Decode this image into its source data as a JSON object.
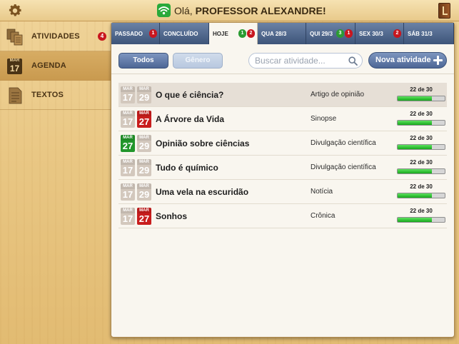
{
  "header": {
    "greeting_prefix": "Olá, ",
    "greeting_name": "PROFESSOR ALEXANDRE!"
  },
  "icons": {
    "settings": "gear-icon",
    "connection": "wifi-icon",
    "library": "book-icon"
  },
  "sidebar": {
    "items": [
      {
        "label": "ATIVIDADES",
        "icon": "documents-icon",
        "badge": "4",
        "active": false
      },
      {
        "label": "AGENDA",
        "icon": "calendar-icon",
        "cal_month": "MAR",
        "cal_day": "17",
        "active": true
      },
      {
        "label": "TEXTOS",
        "icon": "text-document-icon",
        "active": false
      }
    ]
  },
  "tabs": [
    {
      "label": "PASSADO",
      "badges": [
        {
          "value": "1",
          "color": "red"
        }
      ]
    },
    {
      "label": "CONCLUÍDO",
      "badges": []
    },
    {
      "label": "HOJE",
      "active": true,
      "badges": [
        {
          "value": "1",
          "color": "green"
        },
        {
          "value": "2",
          "color": "red"
        }
      ]
    },
    {
      "label": "QUA 28/3",
      "badges": []
    },
    {
      "label": "QUI 29/3",
      "badges": [
        {
          "value": "3",
          "color": "green"
        },
        {
          "value": "1",
          "color": "red"
        }
      ]
    },
    {
      "label": "SEX 30/3",
      "badges": [
        {
          "value": "2",
          "color": "red"
        }
      ]
    },
    {
      "label": "SÁB 31/3",
      "badges": []
    }
  ],
  "toolbar": {
    "todos_label": "Todos",
    "genero_label": "Gênero",
    "search_placeholder": "Buscar atividade...",
    "nova_label": "Nova atividade"
  },
  "activities": [
    {
      "title": "O que é ciência?",
      "genre": "Artigo de opinião",
      "start": {
        "month": "MAR",
        "day": "17",
        "color": "gray"
      },
      "end": {
        "month": "MAR",
        "day": "29",
        "color": "gray"
      },
      "progress_label": "22 de 30",
      "progress": 0.73,
      "selected": true
    },
    {
      "title": "A Árvore da Vida",
      "genre": "Sinopse",
      "start": {
        "month": "MAR",
        "day": "17",
        "color": "gray"
      },
      "end": {
        "month": "MAR",
        "day": "27",
        "color": "red"
      },
      "progress_label": "22 de 30",
      "progress": 0.73
    },
    {
      "title": "Opinião sobre ciências",
      "genre": "Divulgação científica",
      "start": {
        "month": "MAR",
        "day": "27",
        "color": "green"
      },
      "end": {
        "month": "MAR",
        "day": "29",
        "color": "gray"
      },
      "progress_label": "22 de 30",
      "progress": 0.73
    },
    {
      "title": "Tudo é químico",
      "genre": "Divulgação científica",
      "start": {
        "month": "MAR",
        "day": "17",
        "color": "gray"
      },
      "end": {
        "month": "MAR",
        "day": "29",
        "color": "gray"
      },
      "progress_label": "22 de 30",
      "progress": 0.73
    },
    {
      "title": "Uma vela na escuridão",
      "genre": "Notícia",
      "start": {
        "month": "MAR",
        "day": "17",
        "color": "gray"
      },
      "end": {
        "month": "MAR",
        "day": "29",
        "color": "gray"
      },
      "progress_label": "22 de 30",
      "progress": 0.73
    },
    {
      "title": "Sonhos",
      "genre": "Crônica",
      "start": {
        "month": "MAR",
        "day": "17",
        "color": "gray"
      },
      "end": {
        "month": "MAR",
        "day": "27",
        "color": "red"
      },
      "progress_label": "22 de 30",
      "progress": 0.73
    }
  ],
  "colors": {
    "accent_blue": "#4d6796",
    "badge_red": "#c8161e",
    "badge_green": "#2b9b33",
    "progress_green": "#17a81c"
  }
}
